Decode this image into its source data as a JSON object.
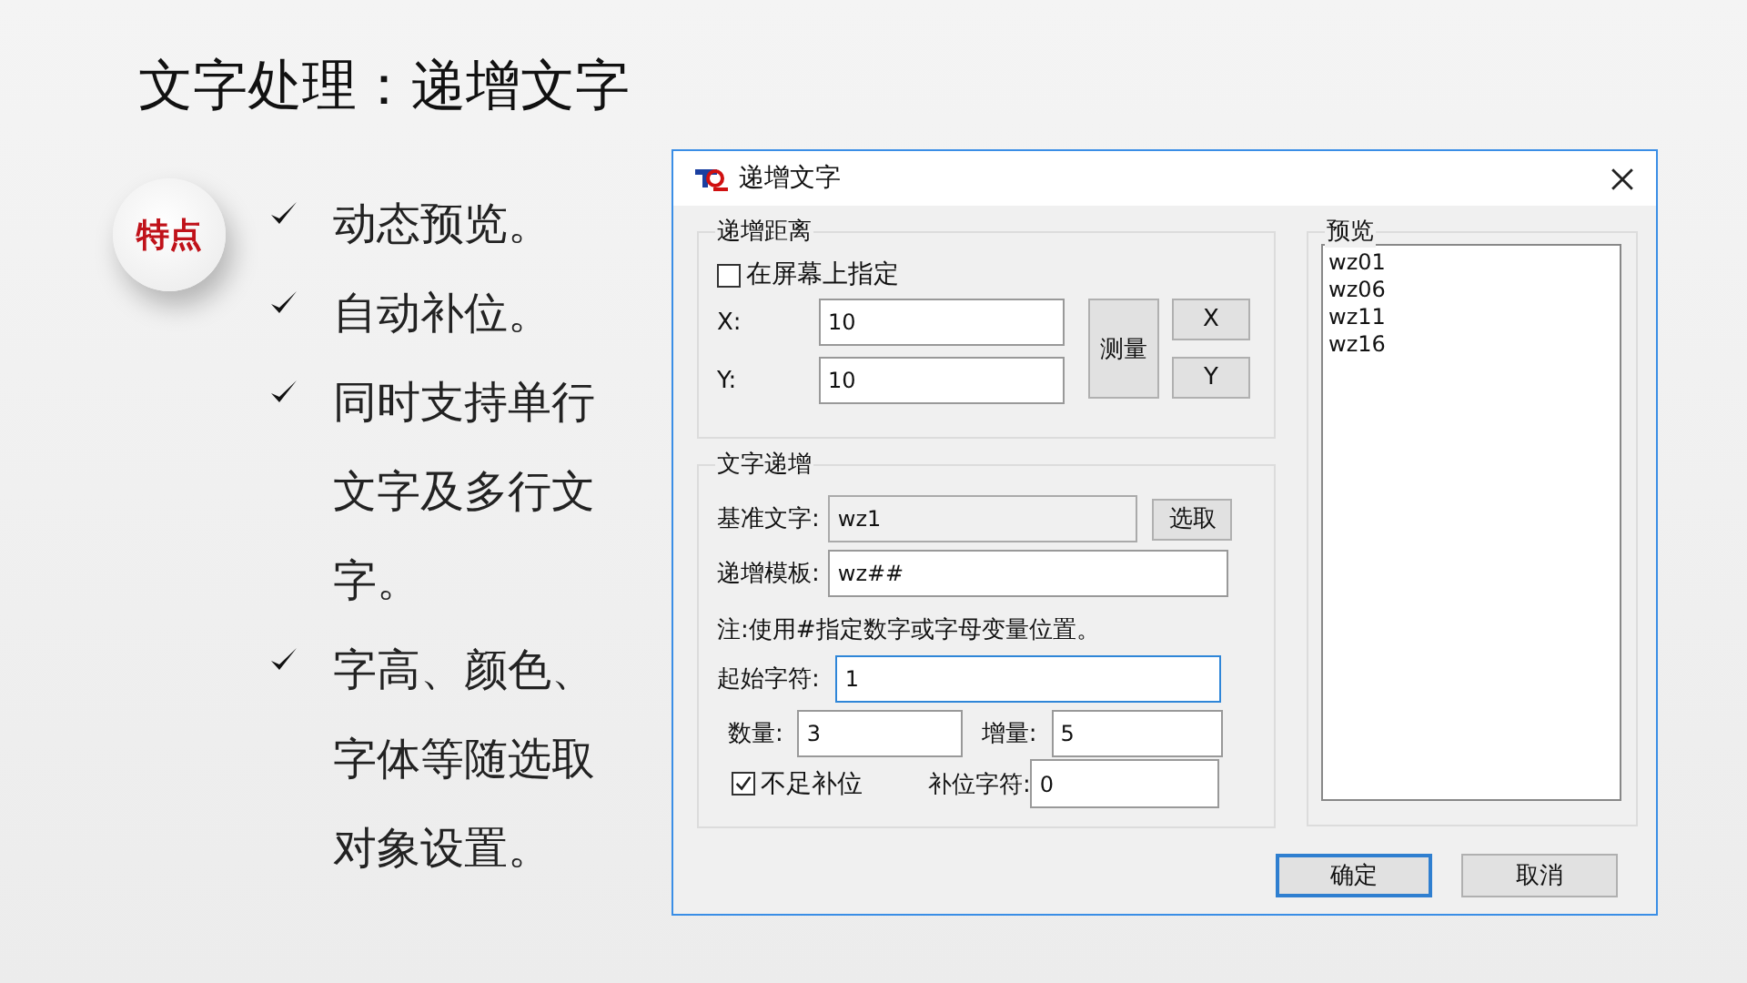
{
  "slide": {
    "title": "文字处理：递增文字",
    "badge": "特点",
    "bullets": [
      "动态预览。",
      "自动补位。",
      "同时支持单行文字及多行文字。",
      "字高、颜色、字体等随选取对象设置。"
    ]
  },
  "dialog": {
    "title": "递增文字",
    "distance_group": {
      "label": "递增距离",
      "on_screen": {
        "label": "在屏幕上指定",
        "checked": false
      },
      "fields": [
        {
          "label": "X:",
          "value": "10"
        },
        {
          "label": "Y:",
          "value": "10"
        }
      ],
      "measure_button": "测量",
      "axis_buttons": [
        "X",
        "Y"
      ]
    },
    "text_group": {
      "label": "文字递增",
      "base_text": {
        "label": "基准文字:",
        "value": "wz1",
        "disabled": true
      },
      "pick_button": "选取",
      "template": {
        "label": "递增模板:",
        "value": "wz##"
      },
      "note": "注:使用#指定数字或字母变量位置。",
      "start_char": {
        "label": "起始字符:",
        "value": "1",
        "focused": true
      },
      "count": {
        "label": "数量:",
        "value": "3"
      },
      "increment": {
        "label": "增量:",
        "value": "5"
      },
      "pad": {
        "label": "不足补位",
        "checked": true
      },
      "pad_char": {
        "label": "补位字符:",
        "value": "0"
      }
    },
    "preview": {
      "label": "预览",
      "items": [
        "wz01",
        "wz06",
        "wz11",
        "wz16"
      ]
    },
    "buttons": [
      {
        "label": "确定",
        "default": true
      },
      {
        "label": "取消",
        "default": false
      }
    ]
  }
}
